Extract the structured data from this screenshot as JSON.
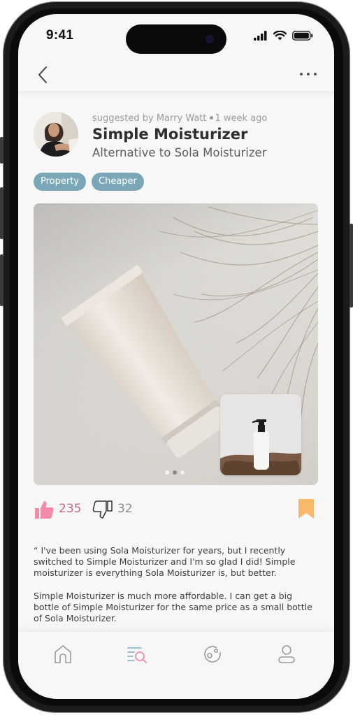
{
  "status_bar": {
    "time": "9:41"
  },
  "header": {
    "back_icon": "chevron-left-icon",
    "more_icon": "ellipsis-icon"
  },
  "post": {
    "meta": {
      "suggested_by": "suggested by Marry Watt",
      "time_ago": "1 week ago"
    },
    "title": "Simple Moisturizer",
    "subtitle": "Alternative to Sola Moisturizer",
    "tags": [
      "Property",
      "Cheaper"
    ],
    "tag_color": "#7aa7b8",
    "gallery": {
      "page_count": 3,
      "active_page": 1
    },
    "likes": "235",
    "dislikes": "32",
    "like_color": "#f28aa8",
    "bookmark_color": "#f9b86a",
    "review_paragraphs": [
      "“ I've been using Sola Moisturizer for years, but I recently switched to Simple Moisturizer and I'm so glad I did! Simple moisturizer is everything Sola Moisturizer is, but better.",
      " Simple Moisturizer is much more affordable. I can get a big bottle of Simple Moisturizer for the same price as a small bottle of Sola Moisturizer."
    ]
  },
  "tab_bar": {
    "items": [
      "home-icon",
      "search-list-icon",
      "explore-icon",
      "profile-icon"
    ],
    "active_index": 1,
    "active_colors": [
      "#8fb7c6",
      "#f28aa8"
    ]
  }
}
